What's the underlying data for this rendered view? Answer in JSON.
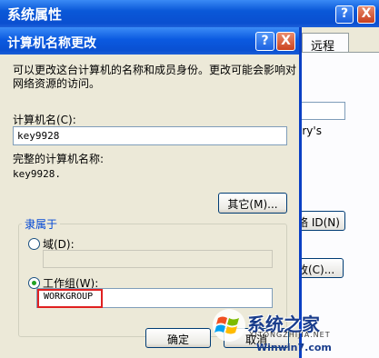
{
  "back_window": {
    "title": "系统属性",
    "help": "?",
    "close": "X",
    "tab_label": "远程",
    "partial_text": "ary's",
    "partial_button1": "络 ID(N)",
    "partial_button2": "改(C)..."
  },
  "dialog": {
    "title": "计算机名称更改",
    "help": "?",
    "close": "X",
    "description": "可以更改这台计算机的名称和成员身份。更改可能会影响对网络资源的访问。",
    "computer_name_label": "计算机名(C):",
    "computer_name_value": "key9928",
    "full_name_label": "完整的计算机名称:",
    "full_name_value": "key9928.",
    "other_button": "其它(M)...",
    "member_of_legend": "隶属于",
    "domain_label": "域(D):",
    "domain_value": "",
    "workgroup_label": "工作组(W):",
    "workgroup_value": "WORKGROUP",
    "workgroup_selected": true,
    "ok_button": "确定",
    "cancel_button": "取消"
  },
  "watermark": {
    "name": "系统之家",
    "subtitle": "XITONGZHIJIA.NET",
    "url": "Winwin7.com"
  },
  "colors": {
    "title_bar": "#0a58d8",
    "dialog_face": "#ece9d8",
    "highlight_box": "#e02020",
    "group_legend": "#0046d5"
  }
}
